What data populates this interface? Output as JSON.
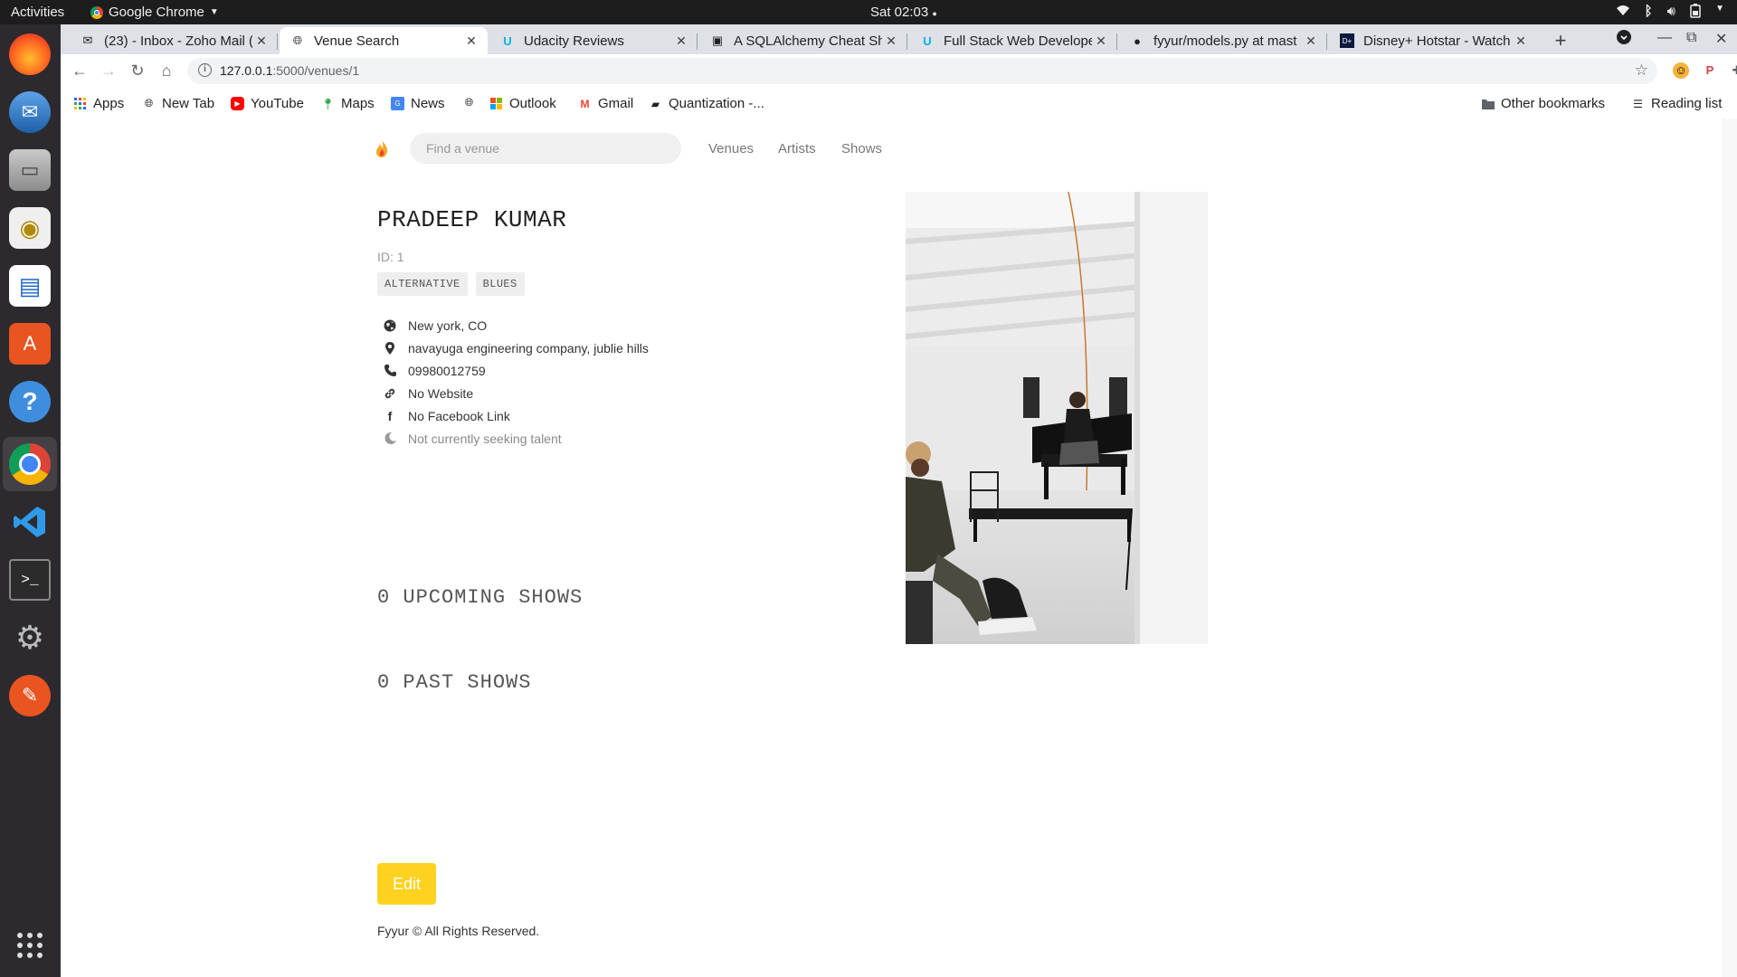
{
  "os": {
    "activities": "Activities",
    "app_name": "Google Chrome",
    "clock": "Sat 02:03"
  },
  "browser": {
    "tabs": [
      {
        "label": "(23) - Inbox - Zoho Mail (p",
        "icon": "mail-icon"
      },
      {
        "label": "Venue Search",
        "icon": "globe-icon",
        "active": true
      },
      {
        "label": "Udacity Reviews",
        "icon": "udacity-icon"
      },
      {
        "label": "A SQLAlchemy Cheat She",
        "icon": "doc-icon"
      },
      {
        "label": "Full Stack Web Develope",
        "icon": "udacity-icon"
      },
      {
        "label": "fyyur/models.py at mast",
        "icon": "github-icon"
      },
      {
        "label": "Disney+ Hotstar - Watch",
        "icon": "hotstar-icon"
      }
    ],
    "url_host": "127.0.0.1",
    "url_path": ":5000/venues/1",
    "bookmarks": [
      {
        "label": "Apps",
        "icon": "apps-grid-icon"
      },
      {
        "label": "New Tab",
        "icon": "globe-icon"
      },
      {
        "label": "YouTube",
        "icon": "youtube-icon"
      },
      {
        "label": "Maps",
        "icon": "maps-icon"
      },
      {
        "label": "News",
        "icon": "news-icon"
      },
      {
        "label": "",
        "icon": "globe-icon"
      },
      {
        "label": "Outlook",
        "icon": "outlook-icon"
      },
      {
        "label": "Gmail",
        "icon": "gmail-icon"
      },
      {
        "label": "Quantization -...",
        "icon": "doc-icon"
      }
    ],
    "other_bookmarks": "Other bookmarks",
    "reading_list": "Reading list"
  },
  "site": {
    "search_placeholder": "Find a venue",
    "nav": [
      "Venues",
      "Artists",
      "Shows"
    ]
  },
  "venue": {
    "name": "PRADEEP KUMAR",
    "id_text": "ID: 1",
    "genres": [
      "ALTERNATIVE",
      "BLUES"
    ],
    "location": "New york, CO",
    "address": "navayuga engineering company, jublie hills",
    "phone": "09980012759",
    "website": "No Website",
    "facebook": "No Facebook Link",
    "seeking": "Not currently seeking talent"
  },
  "shows": {
    "upcoming": "0 UPCOMING SHOWS",
    "past": "0 PAST SHOWS"
  },
  "edit_label": "Edit",
  "footer": "Fyyur © All Rights Reserved.",
  "colors": {
    "edit_button": "#ffd21f",
    "tabstrip": "#dee1e6",
    "dock": "#2c2a2e"
  }
}
